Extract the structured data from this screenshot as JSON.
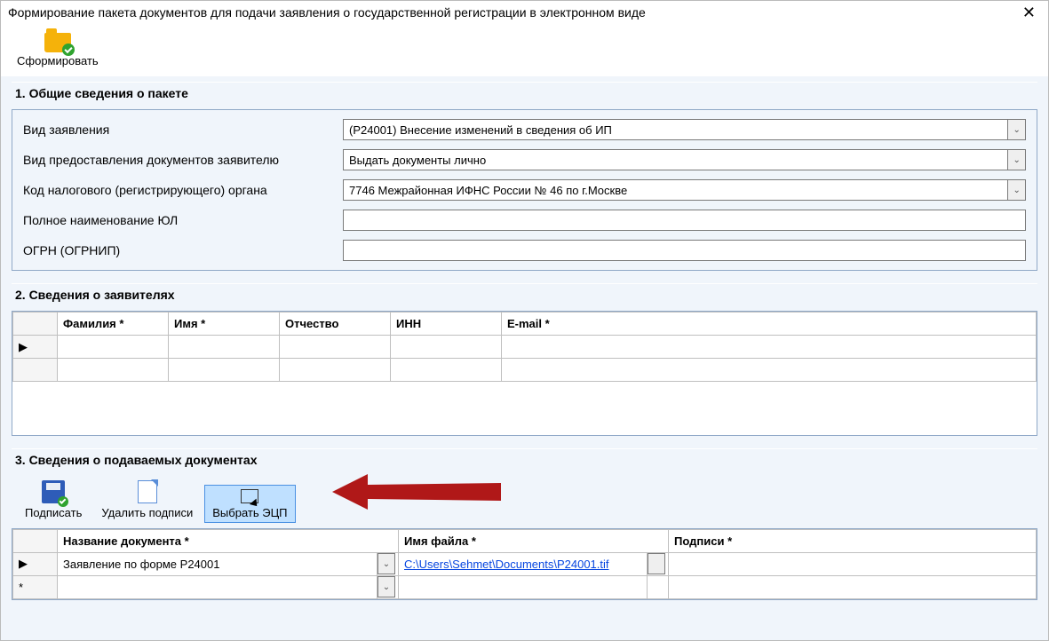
{
  "window": {
    "title": "Формирование пакета документов для подачи заявления о государственной регистрации в электронном виде"
  },
  "toolbar": {
    "form_button": "Сформировать"
  },
  "section1": {
    "title": "1. Общие сведения о пакете",
    "labels": {
      "app_type": "Вид заявления",
      "delivery": "Вид предоставления документов заявителю",
      "tax_code": "Код налогового (регистрирующего) органа",
      "full_name": "Полное наименование ЮЛ",
      "ogrn": "ОГРН (ОГРНИП)"
    },
    "values": {
      "app_type": "(Р24001) Внесение изменений в сведения об ИП",
      "delivery": "Выдать документы лично",
      "tax_code": "7746 Межрайонная ИФНС России № 46 по г.Москве",
      "full_name": "",
      "ogrn": ""
    }
  },
  "section2": {
    "title": "2. Сведения о заявителях",
    "columns": {
      "lastname": "Фамилия *",
      "firstname": "Имя *",
      "middlename": "Отчество",
      "inn": "ИНН",
      "email": "E-mail *"
    },
    "rows": [
      {
        "lastname": "",
        "firstname": "",
        "middlename": "",
        "inn": "",
        "email": ""
      }
    ]
  },
  "section3": {
    "title": "3. Сведения о подаваемых документах",
    "buttons": {
      "sign": "Подписать",
      "remove": "Удалить подписи",
      "select_ecp": "Выбрать ЭЦП"
    },
    "columns": {
      "doc_name": "Название документа *",
      "file_name": "Имя файла *",
      "signatures": "Подписи *"
    },
    "rows": [
      {
        "doc_name": "Заявление по форме Р24001",
        "file_name": "C:\\Users\\Sehmet\\Documents\\P24001.tif"
      }
    ],
    "glyphs": {
      "row_current": "▶",
      "row_new": "*",
      "dropdown": "⌄"
    }
  }
}
